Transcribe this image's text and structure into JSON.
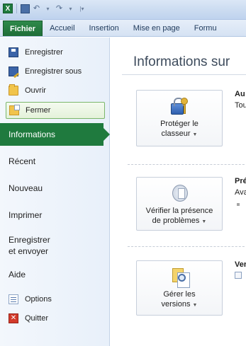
{
  "qat": {
    "app_icon_letter": "X",
    "items": [
      "save-icon",
      "undo-icon",
      "redo-icon",
      "customize-qat-icon"
    ]
  },
  "tabs": [
    "Fichier",
    "Accueil",
    "Insertion",
    "Mise en page",
    "Formu"
  ],
  "nav": {
    "commands_top": [
      {
        "label": "Enregistrer",
        "icon": "save-icon"
      },
      {
        "label": "Enregistrer sous",
        "icon": "save-as-icon"
      },
      {
        "label": "Ouvrir",
        "icon": "open-folder-icon"
      },
      {
        "label": "Fermer",
        "icon": "close-folder-icon"
      }
    ],
    "items": [
      "Informations",
      "Récent",
      "Nouveau",
      "Imprimer",
      "Enregistrer\net envoyer",
      "Aide"
    ],
    "active_item": "Informations",
    "commands_bottom": [
      {
        "label": "Options",
        "icon": "options-icon"
      },
      {
        "label": "Quitter",
        "icon": "quit-icon"
      }
    ]
  },
  "content": {
    "title": "Informations sur",
    "sections": [
      {
        "button_line1": "Protéger le",
        "button_line2": "classeur",
        "heading": "Au",
        "text": "Tou"
      },
      {
        "button_line1": "Vérifier la présence",
        "button_line2": "de problèmes",
        "heading": "Pré",
        "text": "Ava"
      },
      {
        "button_line1": "Gérer les",
        "button_line2": "versions",
        "heading": "Ver",
        "text": ""
      }
    ]
  },
  "colors": {
    "file_tab": "#1f7a3e",
    "active_nav": "#1f7a3e",
    "selected_command_border": "#7bb66b"
  }
}
